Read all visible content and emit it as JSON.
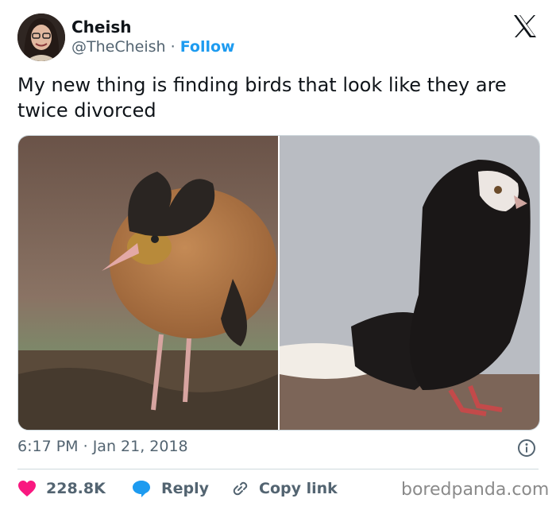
{
  "author": {
    "name": "Cheish",
    "handle": "@TheCheish",
    "separator": "·",
    "follow_label": "Follow",
    "avatar_icon": "user-avatar"
  },
  "platform_logo_icon": "x-logo-icon",
  "tweet": {
    "text": "My new thing is finding birds that look like they are twice divorced"
  },
  "media": {
    "images": [
      "brown-bird-with-black-tuft-photo",
      "black-pigeon-photo"
    ]
  },
  "meta": {
    "time": "6:17 PM",
    "separator": "·",
    "date": "Jan 21, 2018"
  },
  "actions": {
    "likes": "228.8K",
    "reply_label": "Reply",
    "copy_link_label": "Copy link"
  },
  "watermark": "boredpanda.com",
  "colors": {
    "accent": "#1d9bf0",
    "like": "#f91880",
    "secondary_text": "#536471"
  }
}
